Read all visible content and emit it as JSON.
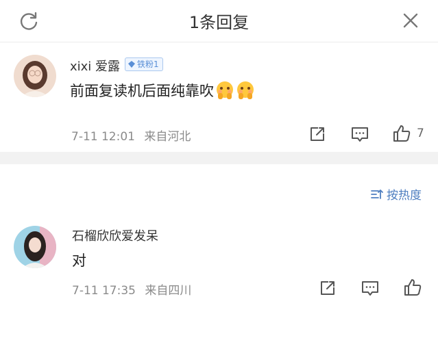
{
  "header": {
    "title": "1条回复"
  },
  "comments": [
    {
      "username": "xixi 爱露",
      "badge": "铁粉1",
      "text": "前面复读机后面纯靠吹",
      "emoji_count": 2,
      "time": "7-11 12:01",
      "source": "来自河北",
      "likes": "7"
    },
    {
      "username": "石榴欣欣爱发呆",
      "text": "对",
      "time": "7-11 17:35",
      "source": "来自四川"
    }
  ],
  "sort": {
    "label": "按热度"
  },
  "icons": {
    "refresh": "refresh-icon",
    "close": "close-icon",
    "share": "share-icon",
    "comment": "comment-icon",
    "like": "thumbs-up-icon",
    "sort": "sort-icon",
    "emoji": "flushed-hands-emoji"
  },
  "colors": {
    "accent": "#4f7fc0",
    "badge": "#5a8fd6",
    "divider": "#f2f2f2"
  }
}
